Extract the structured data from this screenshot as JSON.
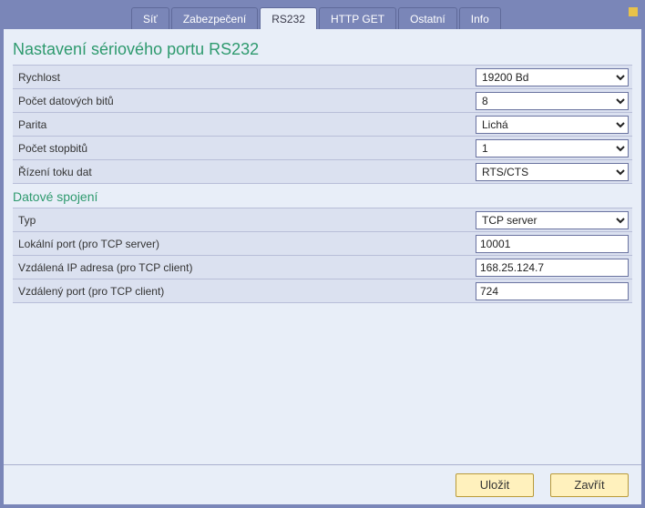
{
  "tabs": {
    "sit": "Síť",
    "zabezpeceni": "Zabezpečení",
    "rs232": "RS232",
    "httpget": "HTTP GET",
    "ostatni": "Ostatní",
    "info": "Info"
  },
  "section_title": "Nastavení sériového portu RS232",
  "rs232": {
    "rychlost_label": "Rychlost",
    "rychlost_value": "19200 Bd",
    "bits_label": "Počet datových bitů",
    "bits_value": "8",
    "parita_label": "Parita",
    "parita_value": "Lichá",
    "stop_label": "Počet stopbitů",
    "stop_value": "1",
    "flow_label": "Řízení toku dat",
    "flow_value": "RTS/CTS"
  },
  "conn_title": "Datové spojení",
  "conn": {
    "typ_label": "Typ",
    "typ_value": "TCP server",
    "lport_label": "Lokální port (pro TCP server)",
    "lport_value": "10001",
    "rip_label": "Vzdálená IP adresa (pro TCP client)",
    "rip_value": "168.25.124.7",
    "rport_label": "Vzdálený port (pro TCP client)",
    "rport_value": "724"
  },
  "buttons": {
    "save": "Uložit",
    "close": "Zavřít"
  }
}
